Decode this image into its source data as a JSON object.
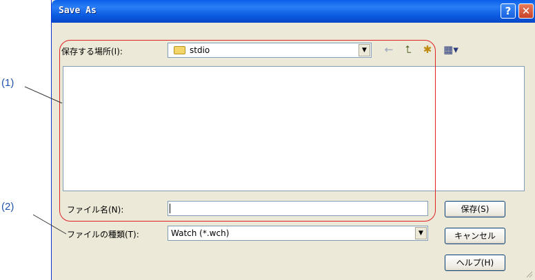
{
  "window": {
    "title": "Save As",
    "help_label": "?",
    "close_label": "✕"
  },
  "location": {
    "label": "保存する場所(I):",
    "value": "stdio",
    "folder_icon": "folder-icon"
  },
  "toolbar": {
    "back_icon": "←",
    "up_icon": "⮤",
    "new_folder_icon": "✱",
    "view_icon": "▦▾"
  },
  "filename": {
    "label": "ファイル名(N):",
    "value": ""
  },
  "filetype": {
    "label": "ファイルの種類(T):",
    "value": "Watch (*.wch)"
  },
  "buttons": {
    "save": "保存(S)",
    "cancel": "キャンセル",
    "help": "ヘルプ(H)"
  },
  "annotations": {
    "one": "(1)",
    "two": "(2)"
  },
  "colors": {
    "titlebar": "#0a5fe8",
    "highlight": "#e02020",
    "annotation_text": "#2050b0"
  }
}
